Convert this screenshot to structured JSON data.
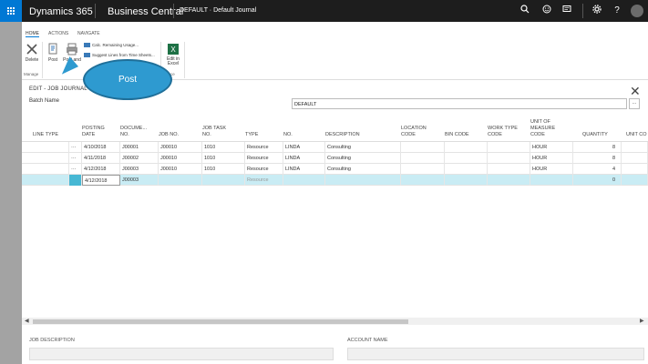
{
  "topbar": {
    "app_name": "Dynamics 365",
    "product": "Business Central",
    "company": "DEFAULT · Default Journal",
    "icons": [
      "search-icon",
      "smiley-icon",
      "chat-icon",
      "gear-icon",
      "help-icon",
      "avatar"
    ]
  },
  "ribbon": {
    "tabs": [
      "HOME",
      "ACTIONS",
      "NAVIGATE"
    ],
    "buttons": {
      "delete": "Delete",
      "post": "Post",
      "post_and_print": "Post and",
      "calc_remaining": "Calc. Remaining Usage...",
      "suggest_lines": "Suggest Lines from Time Sheets...",
      "edit_in_excel": "Edit in Excel"
    },
    "groups": {
      "manage": "Manage",
      "page": "ce"
    }
  },
  "callout": {
    "text": "Post"
  },
  "edit": {
    "title": "EDIT - JOB JOURNAL",
    "batch_label": "Batch Name",
    "batch_value": "DEFAULT",
    "batch_more": "..."
  },
  "grid": {
    "columns": [
      {
        "key": "line_type",
        "lines": [
          "LINE TYPE"
        ]
      },
      {
        "key": "posting_date",
        "lines": [
          "POSTING",
          "DATE"
        ]
      },
      {
        "key": "document_no",
        "lines": [
          "DOCUME...",
          "NO."
        ]
      },
      {
        "key": "job_no",
        "lines": [
          "JOB NO."
        ]
      },
      {
        "key": "job_task_no",
        "lines": [
          "JOB TASK",
          "NO."
        ]
      },
      {
        "key": "type",
        "lines": [
          "TYPE"
        ]
      },
      {
        "key": "no",
        "lines": [
          "NO."
        ]
      },
      {
        "key": "description",
        "lines": [
          "DESCRIPTION"
        ]
      },
      {
        "key": "location_code",
        "lines": [
          "LOCATION",
          "CODE"
        ]
      },
      {
        "key": "bin_code",
        "lines": [
          "BIN CODE"
        ]
      },
      {
        "key": "work_type_code",
        "lines": [
          "WORK TYPE",
          "CODE"
        ]
      },
      {
        "key": "unit_of_measure",
        "lines": [
          "UNIT OF",
          "MEASURE",
          "CODE"
        ]
      },
      {
        "key": "quantity",
        "lines": [
          "QUANTITY"
        ]
      },
      {
        "key": "unit_cost",
        "lines": [
          "UNIT CO"
        ]
      }
    ],
    "rows": [
      {
        "menu": "···",
        "posting_date": "4/10/2018",
        "document_no": "J00001",
        "job_no": "J00010",
        "job_task_no": "1010",
        "type": "Resource",
        "no": "LINDA",
        "description": "Consulting",
        "unit_of_measure": "HOUR",
        "quantity": "8"
      },
      {
        "menu": "···",
        "posting_date": "4/11/2018",
        "document_no": "J00002",
        "job_no": "J00010",
        "job_task_no": "1010",
        "type": "Resource",
        "no": "LINDA",
        "description": "Consulting",
        "unit_of_measure": "HOUR",
        "quantity": "8"
      },
      {
        "menu": "···",
        "posting_date": "4/12/2018",
        "document_no": "J00003",
        "job_no": "J00010",
        "job_task_no": "1010",
        "type": "Resource",
        "no": "LINDA",
        "description": "Consulting",
        "unit_of_measure": "HOUR",
        "quantity": "4"
      },
      {
        "menu": "",
        "posting_date": "4/12/2018",
        "document_no": "J00003",
        "job_no": "",
        "job_task_no": "",
        "type": "Resource",
        "no": "",
        "description": "",
        "unit_of_measure": "",
        "quantity": "0"
      }
    ]
  },
  "bottom": {
    "job_description_label": "JOB DESCRIPTION",
    "account_name_label": "ACCOUNT NAME"
  },
  "colors": {
    "topbar": "#1d1d1d",
    "accent": "#0078d4",
    "selected_row": "#c9ecf4",
    "callout": "#2e9ad0"
  }
}
